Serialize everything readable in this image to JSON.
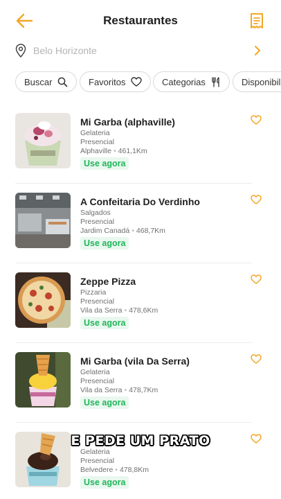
{
  "header": {
    "title": "Restaurantes",
    "back_icon": "arrow-left-icon",
    "action_icon": "receipt-icon",
    "accent": "#f5a623"
  },
  "location": {
    "city": "Belo Horizonte",
    "icon": "map-pin-icon"
  },
  "filters": [
    {
      "label": "Buscar",
      "icon": "search-icon"
    },
    {
      "label": "Favoritos",
      "icon": "heart-icon"
    },
    {
      "label": "Categorias",
      "icon": "cutlery-icon"
    },
    {
      "label": "Disponibili",
      "icon": ""
    }
  ],
  "restaurants": [
    {
      "name": "Mi Garba (alphaville)",
      "category": "Gelateria",
      "mode": "Presencial",
      "area": "Alphaville",
      "distance": "461,1Km",
      "cta": "Use agora"
    },
    {
      "name": "A Confeitaria Do Verdinho",
      "category": "Salgados",
      "mode": "Presencial",
      "area": "Jardim Canadá",
      "distance": "468,7Km",
      "cta": "Use agora"
    },
    {
      "name": "Zeppe Pizza",
      "category": "Pizzaria",
      "mode": "Presencial",
      "area": "Vila da Serra",
      "distance": "478,6Km",
      "cta": "Use agora"
    },
    {
      "name": "Mi Garba (vila Da Serra)",
      "category": "Gelateria",
      "mode": "Presencial",
      "area": "Vila da Serra",
      "distance": "478,7Km",
      "cta": "Use agora"
    },
    {
      "name": "",
      "category": "Gelateria",
      "mode": "Presencial",
      "area": "Belvedere",
      "distance": "478,8Km",
      "cta": "Use agora"
    }
  ],
  "overlay": {
    "caption": "E PEDE UM PRATO"
  },
  "colors": {
    "accent": "#f5a623",
    "green": "#22b55a",
    "green_bg": "#e9f8ef"
  }
}
